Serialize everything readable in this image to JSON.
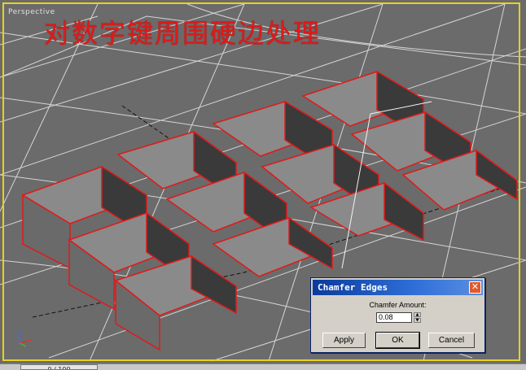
{
  "viewport": {
    "label": "Perspective",
    "overlay_title": "对数字键周围硬边处理"
  },
  "timeline": {
    "frame_text": "0 / 100"
  },
  "dialog": {
    "title": "Chamfer Edges",
    "close_glyph": "✕",
    "amount_label": "Chamfer Amount:",
    "amount_value": "0.08",
    "buttons": {
      "apply": "Apply",
      "ok": "OK",
      "cancel": "Cancel"
    }
  },
  "colors": {
    "viewport_bg": "#6b6b6b",
    "active_border": "#e8d21a",
    "selected_edges": "#e01a1a",
    "grid": "#f0f0f0",
    "titlebar_start": "#0a3a9c"
  }
}
